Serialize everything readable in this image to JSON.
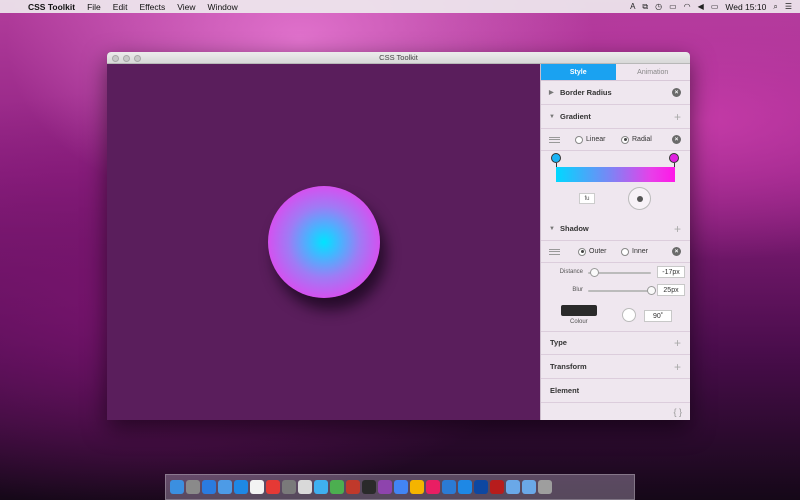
{
  "menubar": {
    "app_name": "CSS Toolkit",
    "items": [
      "File",
      "Edit",
      "Effects",
      "View",
      "Window"
    ],
    "clock": "Wed 15:10"
  },
  "window": {
    "title": "CSS Toolkit"
  },
  "panel": {
    "tabs": [
      "Style",
      "Animation"
    ],
    "active_tab": "Style",
    "sections": {
      "border_radius": "Border Radius",
      "gradient": "Gradient",
      "shadow": "Shadow",
      "type": "Type",
      "transform": "Transform",
      "element": "Element"
    },
    "gradient": {
      "options": [
        "Linear",
        "Radial"
      ],
      "selected": "Radial",
      "stop_colors": [
        "#1ab3f5",
        "#e020e0"
      ],
      "small_field": "fu"
    },
    "shadow": {
      "options": [
        "Outer",
        "Inner"
      ],
      "selected": "Outer",
      "distance_label": "Distance",
      "distance_value": "-17px",
      "distance_level": 0.1,
      "blur_label": "Blur",
      "blur_value": "25px",
      "blur_level": 1.0,
      "colour_label": "Colour",
      "colour": "#2a2a2a",
      "angle_value": "90˚"
    },
    "code_toggle": "{ }"
  },
  "dock": {
    "icons": [
      "finder-icon",
      "launchpad-icon",
      "safari-icon",
      "mail-icon",
      "safari-icon",
      "calendar-icon",
      "itunes-icon",
      "system-preferences-icon",
      "preview-icon",
      "messages-icon",
      "photo-icon",
      "home-icon",
      "fireworks-icon",
      "app-icon",
      "chrome-icon",
      "sketch-icon",
      "app-icon",
      "keynote-icon",
      "app-icon",
      "app-icon",
      "record-icon",
      "folder-icon",
      "folder-icon",
      "trash-icon"
    ]
  }
}
